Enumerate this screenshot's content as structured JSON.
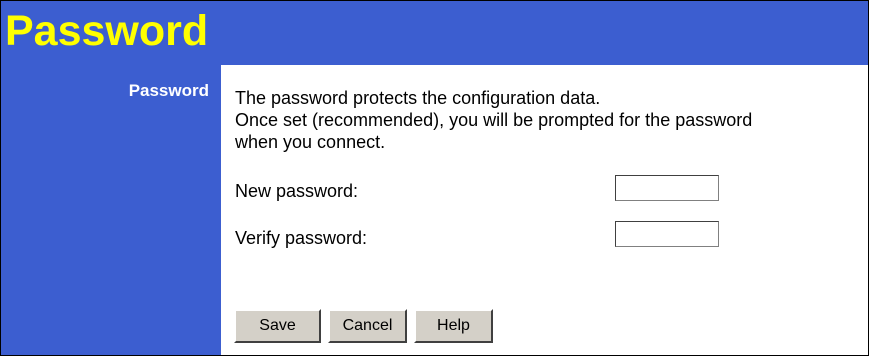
{
  "header": {
    "title": "Password"
  },
  "sidebar": {
    "section_label": "Password"
  },
  "main": {
    "description_lines": [
      "The password protects the configuration data.",
      "Once set (recommended), you will be prompted for the password",
      "when you connect."
    ],
    "fields": [
      {
        "label": "New password:",
        "value": ""
      },
      {
        "label": "Verify password:",
        "value": ""
      }
    ]
  },
  "buttons": {
    "save": "Save",
    "cancel": "Cancel",
    "help": "Help"
  },
  "colors": {
    "background_blue": "#3c5ed0",
    "title_yellow": "#ffff00",
    "button_face": "#d4d0c8"
  }
}
